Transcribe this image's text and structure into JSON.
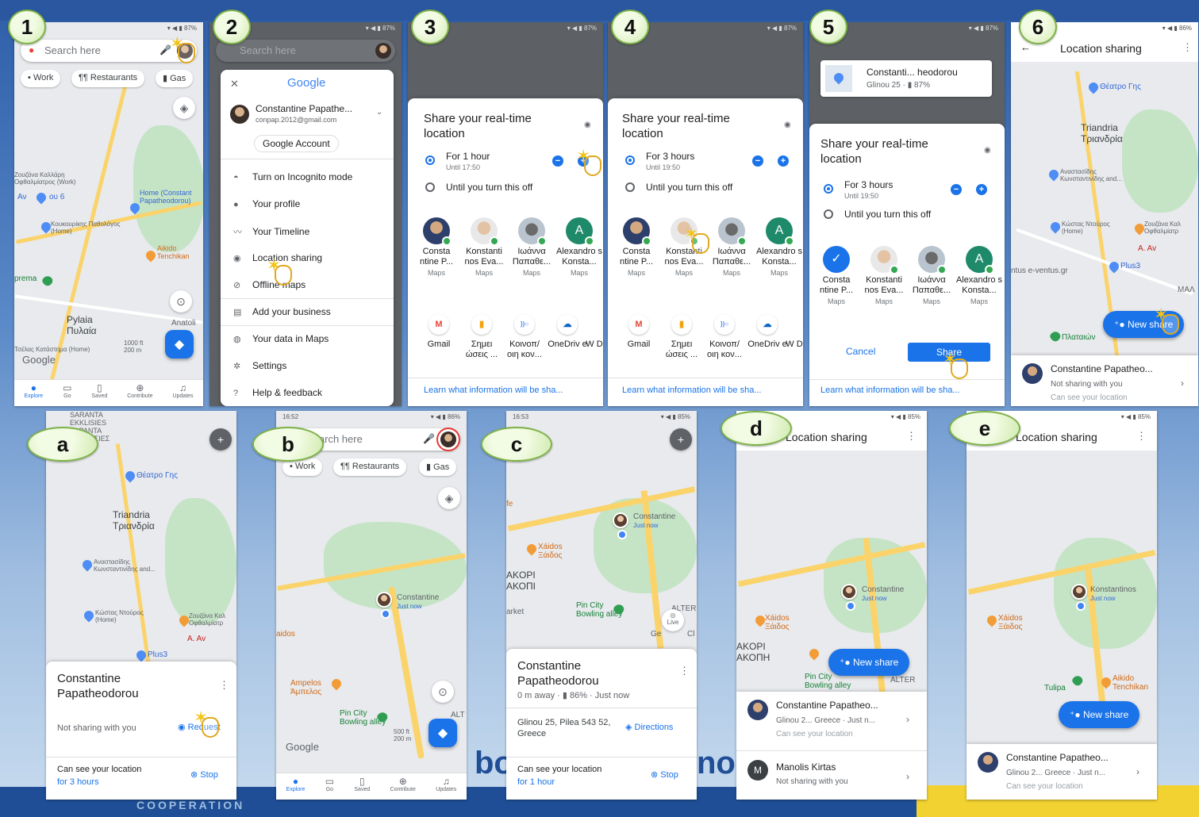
{
  "steps": {
    "s1": "1",
    "s2": "2",
    "s3": "3",
    "s4": "4",
    "s5": "5",
    "s6": "6",
    "sa": "a",
    "sb": "b",
    "sc": "c",
    "sd": "d",
    "se": "e"
  },
  "icons": [
    "search-icon",
    "mic-icon",
    "avatar-icon",
    "layers-icon",
    "my-location-icon",
    "directions-icon",
    "info-icon",
    "plus-icon",
    "minus-icon",
    "more-vert-icon",
    "chevron-right-icon",
    "add-person-icon",
    "tap-hand-icon"
  ],
  "colors": {
    "accent": "#1a73e8",
    "step_badge": "#cfe9ad",
    "banner": "#2a57a0"
  },
  "common": {
    "search_placeholder": "Search here",
    "chips": [
      "Work",
      "Restaurants",
      "Gas"
    ],
    "nav": [
      "Explore",
      "Go",
      "Saved",
      "Contribute",
      "Updates"
    ],
    "share_title": "Share your real-time location",
    "until_off": "Until you turn this off",
    "learn": "Learn what information will be sha...",
    "apps": [
      "Gmail",
      "Σημει ώσεις ...",
      "Κοινοπ/ οιη κον...",
      "OneDriv e",
      "W D"
    ],
    "contacts": [
      "Consta ntine P...",
      "Konstanti nos Eva...",
      "Ιωάννα Παπαθε...",
      "Alexandro s Konsta..."
    ],
    "contact_app": "Maps",
    "location_sharing": "Location sharing",
    "new_share": "New share",
    "constantine_full": "Constantine Papatheo...",
    "can_see": "Can see your location",
    "not_sharing": "Not sharing with you",
    "stop": "Stop",
    "google_logo": "Google"
  },
  "p1": {
    "map_labels": [
      "Ζουζάνα Καλλάρη Οφθαλμίατρος (Work)",
      "Αν",
      "ου 6",
      "Home (Constant Papatheodorou)",
      "Κουκουρίκης Παθολόγος (Home)",
      "Aikido Tenchikan",
      "prema",
      "Pylaia Πυλαία",
      "Anatoli",
      "Τσέλας Κατάστημα (Home)"
    ],
    "scale": "1000 ft 200 m"
  },
  "p2": {
    "account_name": "Constantine Papathe...",
    "account_email": "conpap.2012@gmail.com",
    "google_account": "Google Account",
    "menu": [
      "Turn on Incognito mode",
      "Your profile",
      "Your Timeline",
      "Location sharing",
      "Offline maps",
      "Add your business",
      "Your data in Maps",
      "Settings",
      "Help & feedback"
    ]
  },
  "p3": {
    "duration": "For 1 hour",
    "until": "Until 17:50"
  },
  "p4": {
    "duration": "For 3 hours",
    "until": "Until 19:50"
  },
  "p5": {
    "card_title": "Constanti... heodorou",
    "card_sub": "Glinou 25 · ▮ 87%",
    "duration": "For 3 hours",
    "until": "Until 19:50",
    "cancel": "Cancel",
    "share": "Share"
  },
  "p6": {
    "map_labels": [
      "Θέατρο Γης",
      "Triandria Τριανδρία",
      "Αναστασίδης Κωνσταντινίδης and...",
      "Κώστας Ντούρος (Home)",
      "Ζουζάνα Καλ Οφθαλμίατρ",
      "A. Av",
      "Plus3",
      "ntus e-ventus.gr",
      "ΜΑΛ",
      "Πλαταιών"
    ],
    "row_sub": "Not sharing with you",
    "row_sub2": "Can see your location"
  },
  "pa": {
    "top_labels": [
      "SARANTA",
      "EKKLISIES",
      "ΣΑΡΑΝΤΑ",
      "ΕΚΚΛΗΣΙΕΣ"
    ],
    "map_labels": [
      "Θέατρο Γης",
      "Triandria Τριανδρία",
      "Αναστασίδης Κωνσταντινίδης and...",
      "Κώστας Ντούρος (Home)",
      "Ζουζάνα Καλ Οφθαλμίατρ",
      "A. Av",
      "Plus3"
    ],
    "name": "Constantine Papatheodorou",
    "request": "Request",
    "for_3": "for 3 hours"
  },
  "pb": {
    "time": "16:52",
    "map_labels": [
      "Constantine",
      "Just now",
      "aidos",
      "Ampelos Άμπελος",
      "Pin City Bowling alley",
      "Google",
      "ALT"
    ],
    "scale": "500 ft 200 m"
  },
  "pc": {
    "time": "16:53",
    "map_labels": [
      "Constantine",
      "Just now",
      "fe",
      "Xáidos Ξάιδος",
      "AKOPI ΑΚΟΠΙ",
      "arket",
      "Pin City Bowling alley",
      "ALTER",
      "Live",
      "Ge",
      "Cl"
    ],
    "name": "Constantine Papatheodorou",
    "distance": "0 m away · ▮ 86% · Just now",
    "address": "Glinou 25, Pilea 543 52, Greece",
    "directions": "Directions",
    "for_1": "for 1 hour"
  },
  "pd": {
    "map_labels": [
      "Constantine",
      "Just now",
      "Xáidos Ξάιδος",
      "AKOPI ΑΚΟΠΗ",
      "Pin City Bowling alley",
      "ALTER"
    ],
    "row1_sub": "Glinou 2... Greece · Just n...",
    "row2_name": "Manolis Kirtas",
    "m_initial": "M"
  },
  "pe": {
    "map_labels": [
      "Konstantinos",
      "Just now",
      "Xáidos Ξάιδος",
      "Tulipa",
      "Aikido Tenchikan"
    ],
    "row1_sub": "Glinou 2... Greece · Just n..."
  },
  "banner": {
    "bo": "bo",
    "nor": "nor",
    "coop": "COOPERATION"
  }
}
